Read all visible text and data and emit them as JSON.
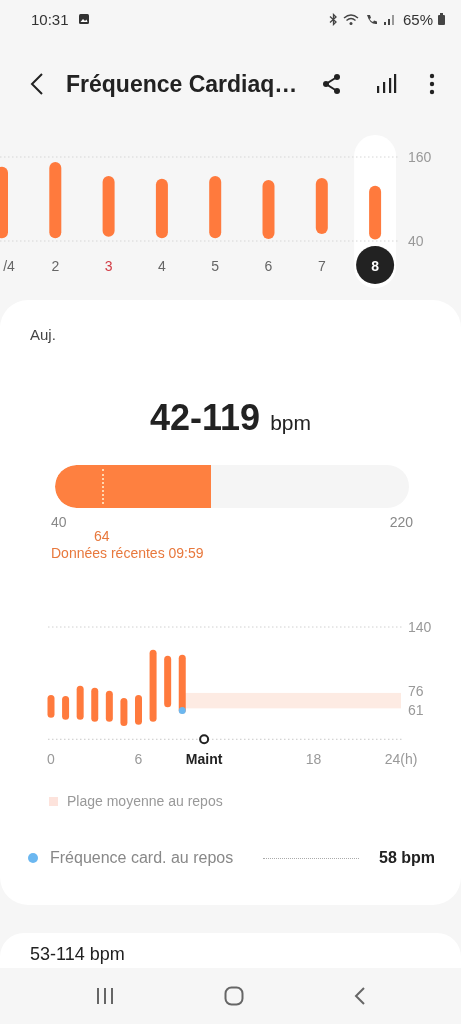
{
  "status_bar": {
    "time": "10:31",
    "battery": "65%"
  },
  "header": {
    "title": "Fréquence Cardiaq…"
  },
  "weekly": {
    "kind": "picture",
    "axis_labels": [
      "160",
      "40"
    ],
    "days": [
      {
        "label": "/4",
        "selected": false,
        "holiday": false
      },
      {
        "label": "2",
        "selected": false,
        "holiday": false
      },
      {
        "label": "3",
        "selected": false,
        "holiday": true
      },
      {
        "label": "4",
        "selected": false,
        "holiday": false
      },
      {
        "label": "5",
        "selected": false,
        "holiday": false
      },
      {
        "label": "6",
        "selected": false,
        "holiday": false
      },
      {
        "label": "7",
        "selected": false,
        "holiday": false
      },
      {
        "label": "8",
        "selected": true,
        "holiday": false
      }
    ]
  },
  "today": {
    "period": "Auj.",
    "range": "42-119",
    "unit": "bpm",
    "gauge": {
      "level": 0.44,
      "min_label": "40",
      "max_label": "220",
      "recent": {
        "value": "64",
        "level": 0.133
      },
      "caption": "Données récentes 09:59"
    }
  },
  "hourly": {
    "kind": "picture",
    "y_labels": [
      "140",
      "76",
      "61"
    ],
    "x_labels": [
      "0",
      "6",
      "18",
      "24(h)"
    ],
    "resting_band": {
      "color": "#fdebe3"
    },
    "resting_point": {
      "color": "#6bb7f0"
    },
    "now_marker": {
      "label": "Maint",
      "level": 0.4375
    },
    "legend": {
      "label": "Plage moyenne au repos",
      "color": "#fde3dc"
    },
    "resting": {
      "label": "Fréquence card. au repos",
      "value": "58 bpm",
      "color": "#6bb7f0"
    }
  },
  "next_card": {
    "range": "53-114 bpm"
  }
}
